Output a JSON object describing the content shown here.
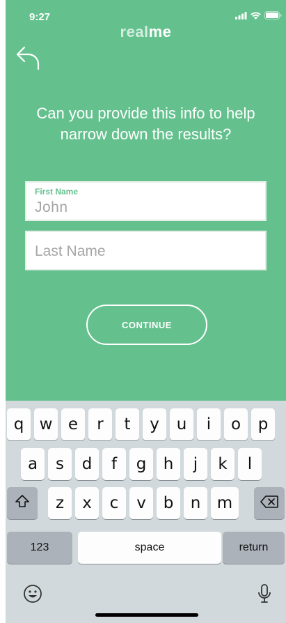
{
  "status_bar": {
    "time": "9:27"
  },
  "logo": {
    "light": "real",
    "bold": "me"
  },
  "prompt": "Can you provide this info to help narrow down the results?",
  "form": {
    "first_name": {
      "label": "First Name",
      "value": "John"
    },
    "last_name": {
      "placeholder": "Last Name"
    },
    "continue_label": "CONTINUE"
  },
  "keyboard": {
    "row1": [
      "q",
      "w",
      "e",
      "r",
      "t",
      "y",
      "u",
      "i",
      "o",
      "p"
    ],
    "row2": [
      "a",
      "s",
      "d",
      "f",
      "g",
      "h",
      "j",
      "k",
      "l"
    ],
    "row3": [
      "z",
      "x",
      "c",
      "v",
      "b",
      "n",
      "m"
    ],
    "numbers_label": "123",
    "space_label": "space",
    "return_label": "return"
  },
  "colors": {
    "brand": "#64c18e",
    "keyboard_bg": "#d1d9dc"
  },
  "icons": [
    "signal-icon",
    "wifi-icon",
    "battery-icon",
    "back-arrow-icon",
    "shift-icon",
    "delete-icon",
    "emoji-icon",
    "microphone-icon"
  ]
}
